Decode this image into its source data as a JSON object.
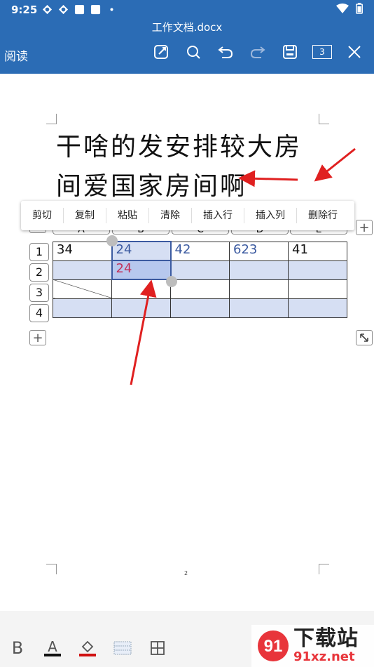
{
  "status_bar": {
    "time": "9:25"
  },
  "header": {
    "doc_title": "工作文档.docx",
    "read_label": "阅读",
    "page_count": "3"
  },
  "document": {
    "heading_line1": "干啥的发安排较大房",
    "heading_line2": "间爱国家房间啊",
    "page_number": "2"
  },
  "context_menu": {
    "items": [
      "剪切",
      "复制",
      "粘贴",
      "清除",
      "插入行",
      "插入列",
      "删除行"
    ]
  },
  "table": {
    "row_headers": [
      "1",
      "2",
      "3",
      "4"
    ],
    "col_headers": [
      "A",
      "B",
      "C",
      "D",
      "E"
    ],
    "rows": [
      [
        "34",
        "24",
        "42",
        "623",
        "41"
      ],
      [
        "",
        "24",
        "",
        "",
        ""
      ],
      [
        "",
        "",
        "",
        "",
        ""
      ],
      [
        "",
        "",
        "",
        "",
        ""
      ]
    ]
  },
  "bottom_toolbar": {
    "bold_label": "B",
    "font_color_label": "A"
  },
  "watermark": {
    "main": "下载站",
    "sub": "91xz.net"
  },
  "colors": {
    "header_bg": "#2b6cb5",
    "selection_blue": "#3b5aa0",
    "selected_cell_fill": "#b7c8ee",
    "banded_row": "#d6dff3",
    "annotation_arrow": "#e02020",
    "pink_text": "#c2315b"
  }
}
